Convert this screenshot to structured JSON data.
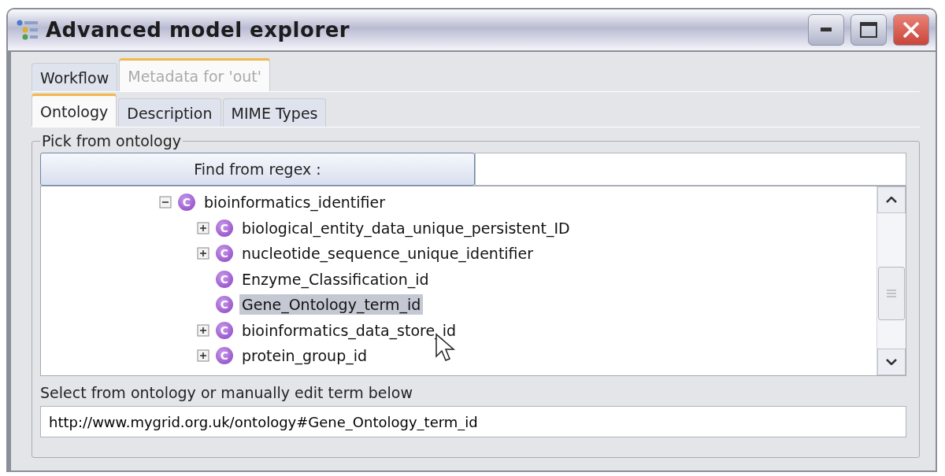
{
  "window": {
    "title": "Advanced model explorer"
  },
  "outer_tabs": [
    {
      "label": "Workflow",
      "selected": false
    },
    {
      "label": "Metadata for 'out'",
      "selected": true
    }
  ],
  "inner_tabs": [
    {
      "label": "Ontology",
      "selected": true
    },
    {
      "label": "Description",
      "selected": false
    },
    {
      "label": "MIME Types",
      "selected": false
    }
  ],
  "group": {
    "title": "Pick from ontology"
  },
  "find_button": {
    "label": "Find from regex :"
  },
  "tree": [
    {
      "label": "bioinformatics_identifier",
      "badge": "C",
      "expanded": true,
      "selected": false,
      "children": [
        {
          "label": "biological_entity_data_unique_persistent_ID",
          "badge": "C",
          "expanded": false,
          "selected": false
        },
        {
          "label": "nucleotide_sequence_unique_identifier",
          "badge": "C",
          "expanded": false,
          "selected": false
        },
        {
          "label": "Enzyme_Classification_id",
          "badge": "C",
          "selected": false
        },
        {
          "label": "Gene_Ontology_term_id",
          "badge": "C",
          "selected": true
        },
        {
          "label": "bioinformatics_data_store_id",
          "badge": "C",
          "expanded": false,
          "selected": false
        },
        {
          "label": "protein_group_id",
          "badge": "C",
          "expanded": false,
          "selected": false
        }
      ]
    }
  ],
  "term_label": "Select from ontology or manually edit term below",
  "term_field": {
    "value": "http://www.mygrid.org.uk/ontology#Gene_Ontology_term_id"
  }
}
